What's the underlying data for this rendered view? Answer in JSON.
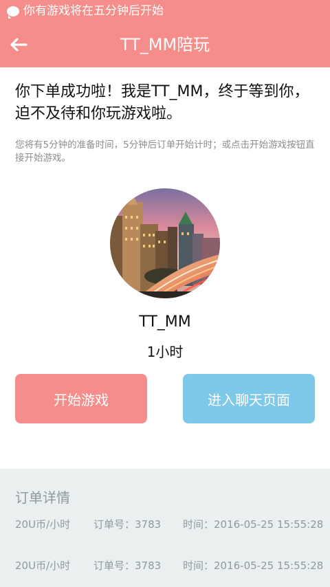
{
  "status_bar": {
    "notification_text": "你有游戏将在五分钟后开始",
    "icon": "chat-bubble-icon"
  },
  "header": {
    "back_icon": "back-arrow-icon",
    "title": "TT_MM陪玩"
  },
  "main": {
    "headline": "你下单成功啦！我是TT_MM，终于等到你，迫不及待和你玩游戏啦。",
    "subnote": "您将有5分钟的准备时间，5分钟后订单开始计时；或点击开始游戏按钮直接开始游戏。",
    "companion_name": "TT_MM",
    "duration": "1小时",
    "start_button": "开始游戏",
    "chat_button": "进入聊天页面"
  },
  "order_details": {
    "title": "订单详情",
    "rows": [
      {
        "price": "20U币/小时",
        "order_no": "订单号：3783",
        "time": "时间：2016-05-25 15:55:28"
      },
      {
        "price": "20U币/小时",
        "order_no": "订单号：3783",
        "time": "时间：2016-05-25 15:55:28"
      }
    ]
  },
  "colors": {
    "accent": "#f58d8a",
    "chat_button": "#7ec8ea",
    "panel_bg": "#eaeff0"
  }
}
